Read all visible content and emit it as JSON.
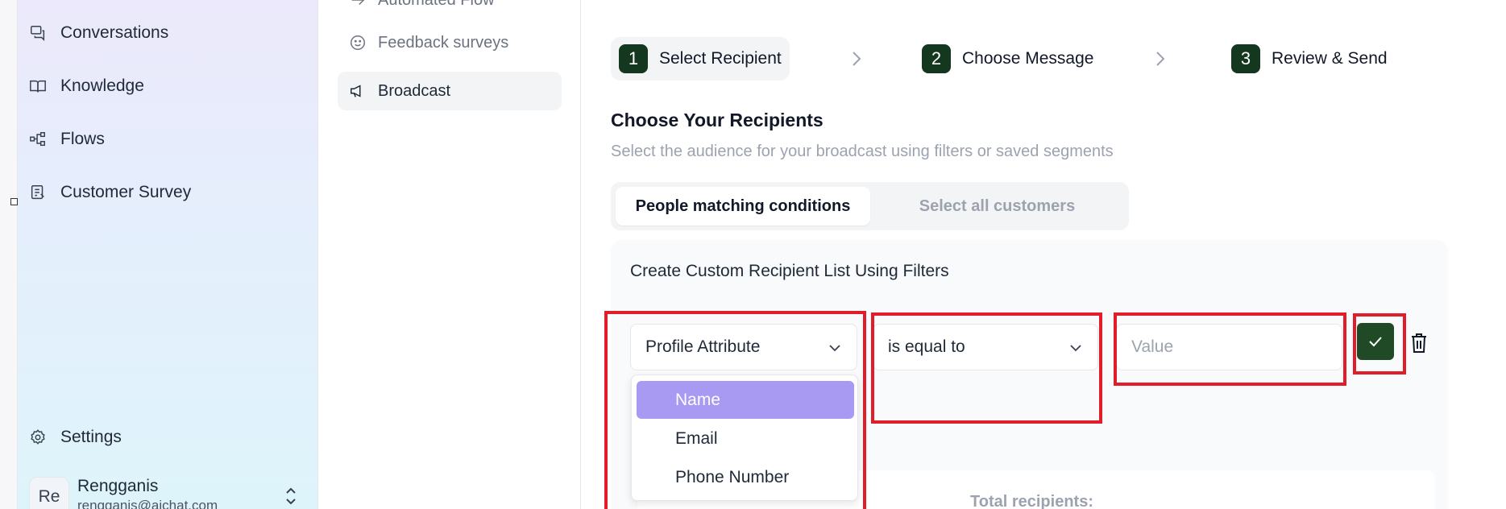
{
  "sidebar": {
    "items": [
      {
        "label": "Conversations",
        "icon": "chat-icon"
      },
      {
        "label": "Knowledge",
        "icon": "book-icon"
      },
      {
        "label": "Flows",
        "icon": "flow-icon"
      },
      {
        "label": "Customer Survey",
        "icon": "survey-icon"
      }
    ],
    "settings_label": "Settings",
    "user": {
      "initials": "Re",
      "name": "Rengganis",
      "email": "rengganis@aichat.com"
    }
  },
  "subnav": {
    "items": [
      {
        "label": "Automated Flow",
        "active": false
      },
      {
        "label": "Feedback surveys",
        "active": false
      },
      {
        "label": "Broadcast",
        "active": true
      }
    ]
  },
  "steps": [
    {
      "number": "1",
      "label": "Select Recipient",
      "active": true
    },
    {
      "number": "2",
      "label": "Choose Message",
      "active": false
    },
    {
      "number": "3",
      "label": "Review & Send",
      "active": false
    }
  ],
  "main": {
    "title": "Choose Your Recipients",
    "subtitle": "Select the audience for your broadcast using filters or saved segments",
    "tabs": [
      {
        "label": "People matching conditions",
        "selected": true
      },
      {
        "label": "Select all customers",
        "selected": false
      }
    ],
    "panel_title": "Create Custom Recipient List Using Filters",
    "filter": {
      "attribute": "Profile Attribute",
      "operator": "is equal to",
      "value_placeholder": "Value"
    },
    "dropdown_options": [
      "Name",
      "Email",
      "Phone Number"
    ],
    "highlighted_option": "Name",
    "total_recipients_label": "Total recipients:"
  },
  "colors": {
    "step_badge": "#14371f",
    "confirm_button": "#1f4a25",
    "option_highlight": "#a89af2",
    "annotation_red": "#e11d2a"
  }
}
